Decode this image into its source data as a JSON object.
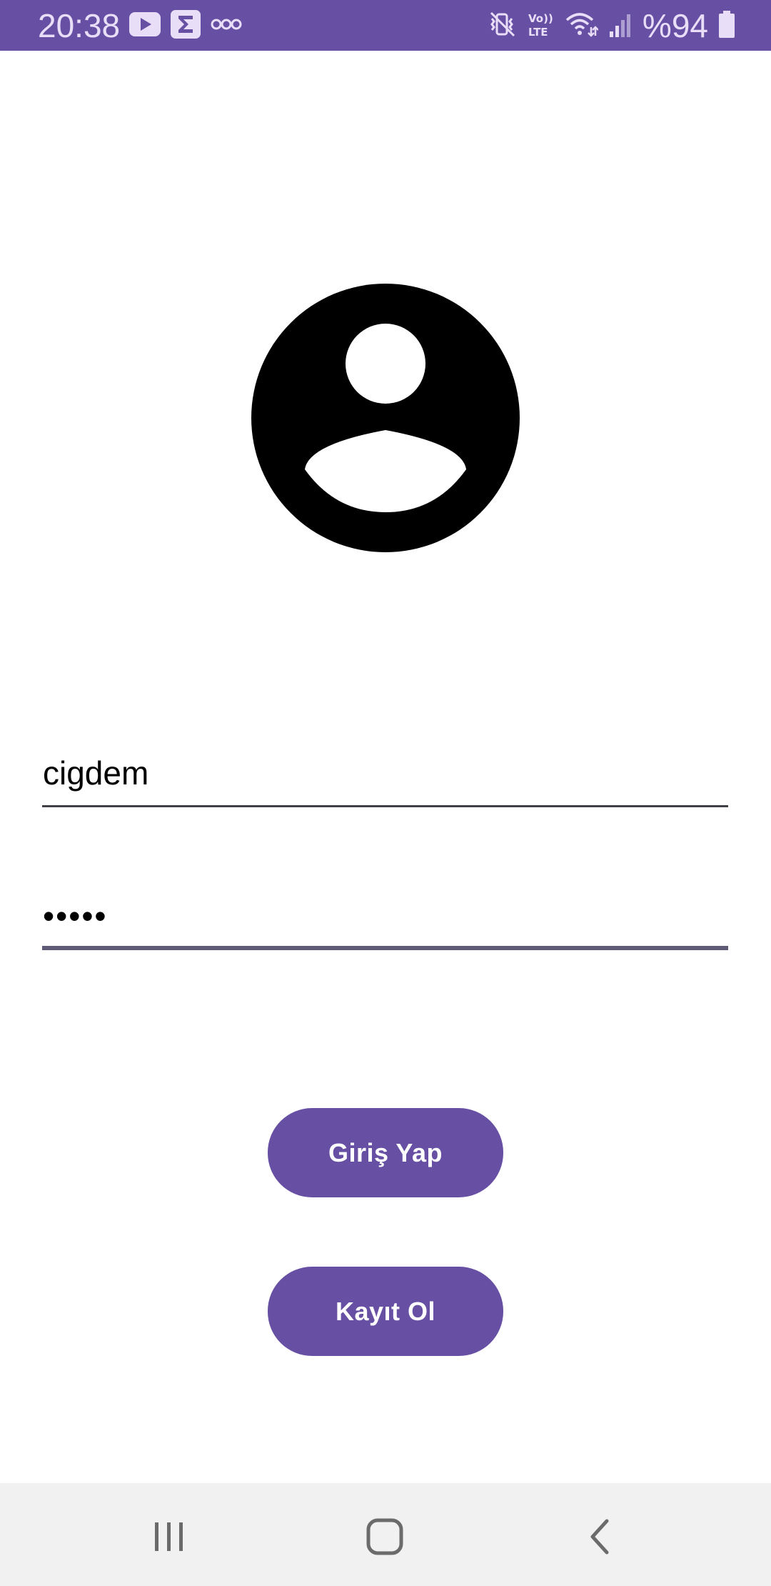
{
  "status_bar": {
    "time": "20:38",
    "battery": "%94",
    "colors": {
      "background": "#6750a4",
      "foreground": "#e8def8"
    },
    "left_icons": [
      "youtube-icon",
      "sigma-app-icon",
      "voicemail-icon"
    ],
    "right_icons": [
      "mute-vibrate-icon",
      "volte-icon",
      "wifi-icon",
      "signal-icon",
      "battery-icon"
    ]
  },
  "avatar": {
    "icon": "account-circle-icon"
  },
  "form": {
    "username_value": "cigdem",
    "password_value": "•••••"
  },
  "buttons": {
    "login_label": "Giriş Yap",
    "register_label": "Kayıt Ol",
    "color": "#6750a4"
  },
  "nav_bar": {
    "icons": [
      "recent-apps-icon",
      "home-icon",
      "back-icon"
    ]
  }
}
